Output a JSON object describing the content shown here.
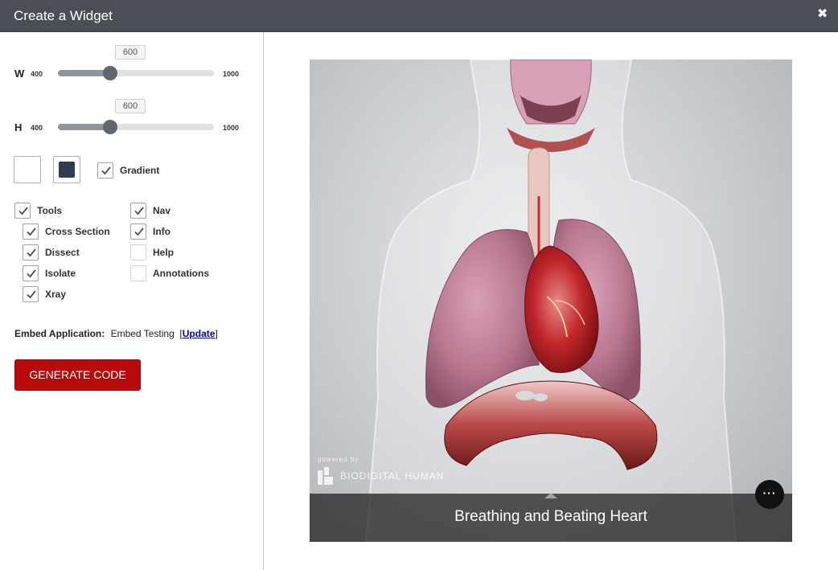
{
  "window": {
    "title": "Create a Widget",
    "close_icon": "close-icon"
  },
  "width_slider": {
    "axis_label": "W",
    "min": "400",
    "max": "1000",
    "value": "600",
    "fraction": 0.333
  },
  "height_slider": {
    "axis_label": "H",
    "min": "400",
    "max": "1000",
    "value": "600",
    "fraction": 0.333
  },
  "background": {
    "color1": "#ffffff",
    "color2": "#2c3e50",
    "gradient": {
      "label": "Gradient",
      "checked": true
    }
  },
  "options_left": [
    {
      "label": "Tools",
      "checked": true
    },
    {
      "label": "Cross Section",
      "checked": true
    },
    {
      "label": "Dissect",
      "checked": true
    },
    {
      "label": "Isolate",
      "checked": true
    },
    {
      "label": "Xray",
      "checked": true
    }
  ],
  "options_right": [
    {
      "label": "Nav",
      "checked": true
    },
    {
      "label": "Info",
      "checked": true
    },
    {
      "label": "Help",
      "checked": false
    },
    {
      "label": "Annotations",
      "checked": false
    }
  ],
  "embed": {
    "label": "Embed Application:",
    "value": "Embed Testing",
    "update_link": "Update"
  },
  "generate_button": "GENERATE CODE",
  "preview": {
    "powered_by": "powered by",
    "brand": "BIODIGITAL HUMAN",
    "caption": "Breathing and Beating Heart",
    "more_icon": "more-icon"
  },
  "colors": {
    "accent": "#b80a0a",
    "titlebar": "#4a4f56",
    "slider_thumb": "#5e676d"
  }
}
